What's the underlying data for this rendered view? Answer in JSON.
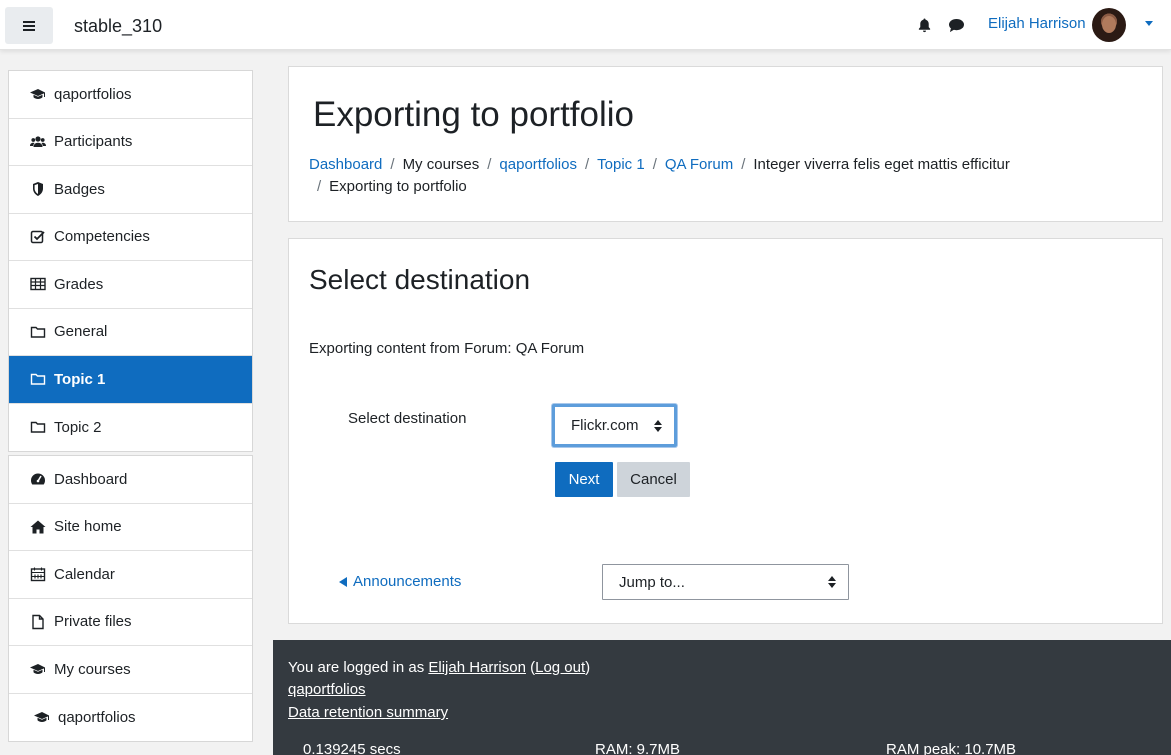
{
  "header": {
    "site_name": "stable_310",
    "user_name": "Elijah Harrison",
    "icons": [
      "menu-icon",
      "bell-icon",
      "chat-icon",
      "caret-down-icon"
    ]
  },
  "sidebar": {
    "course_items": [
      {
        "label": "qaportfolios",
        "icon": "graduation-cap-icon"
      },
      {
        "label": "Participants",
        "icon": "users-icon"
      },
      {
        "label": "Badges",
        "icon": "shield-icon"
      },
      {
        "label": "Competencies",
        "icon": "check-square-icon"
      },
      {
        "label": "Grades",
        "icon": "table-icon"
      },
      {
        "label": "General",
        "icon": "folder-icon"
      },
      {
        "label": "Topic 1",
        "icon": "folder-icon",
        "active": true
      },
      {
        "label": "Topic 2",
        "icon": "folder-icon"
      }
    ],
    "site_items": [
      {
        "label": "Dashboard",
        "icon": "tachometer-icon"
      },
      {
        "label": "Site home",
        "icon": "home-icon"
      },
      {
        "label": "Calendar",
        "icon": "calendar-icon"
      },
      {
        "label": "Private files",
        "icon": "file-icon"
      },
      {
        "label": "My courses",
        "icon": "graduation-cap-icon"
      },
      {
        "label": "qaportfolios",
        "icon": "graduation-cap-icon"
      }
    ]
  },
  "page": {
    "title": "Exporting to portfolio",
    "breadcrumb": {
      "dashboard": "Dashboard",
      "my_courses": "My courses",
      "course": "qaportfolios",
      "topic": "Topic 1",
      "forum": "QA Forum",
      "discussion": "Integer viverra felis eget mattis efficitur",
      "current": "Exporting to portfolio",
      "separator": "/"
    }
  },
  "form": {
    "section_title": "Select destination",
    "export_text": "Exporting content from Forum: QA Forum",
    "destination_label": "Select destination",
    "destination_value": "Flickr.com",
    "next_label": "Next",
    "cancel_label": "Cancel",
    "prev_activity": "Announcements",
    "jump_to": "Jump to..."
  },
  "footer": {
    "logged_in_prefix": "You are logged in as ",
    "user_name": "Elijah Harrison",
    "open_paren": " (",
    "logout": "Log out",
    "close_paren": ")",
    "course_link": "qaportfolios",
    "data_retention": "Data retention summary",
    "perf_time": "0.139245 secs",
    "perf_ram": "RAM: 9.7MB",
    "perf_ram_peak": "RAM peak: 10.7MB"
  },
  "colors": {
    "brand_blue": "#0f6cbf",
    "footer_bg": "#343a40",
    "cancel_bg": "#ced4da"
  }
}
